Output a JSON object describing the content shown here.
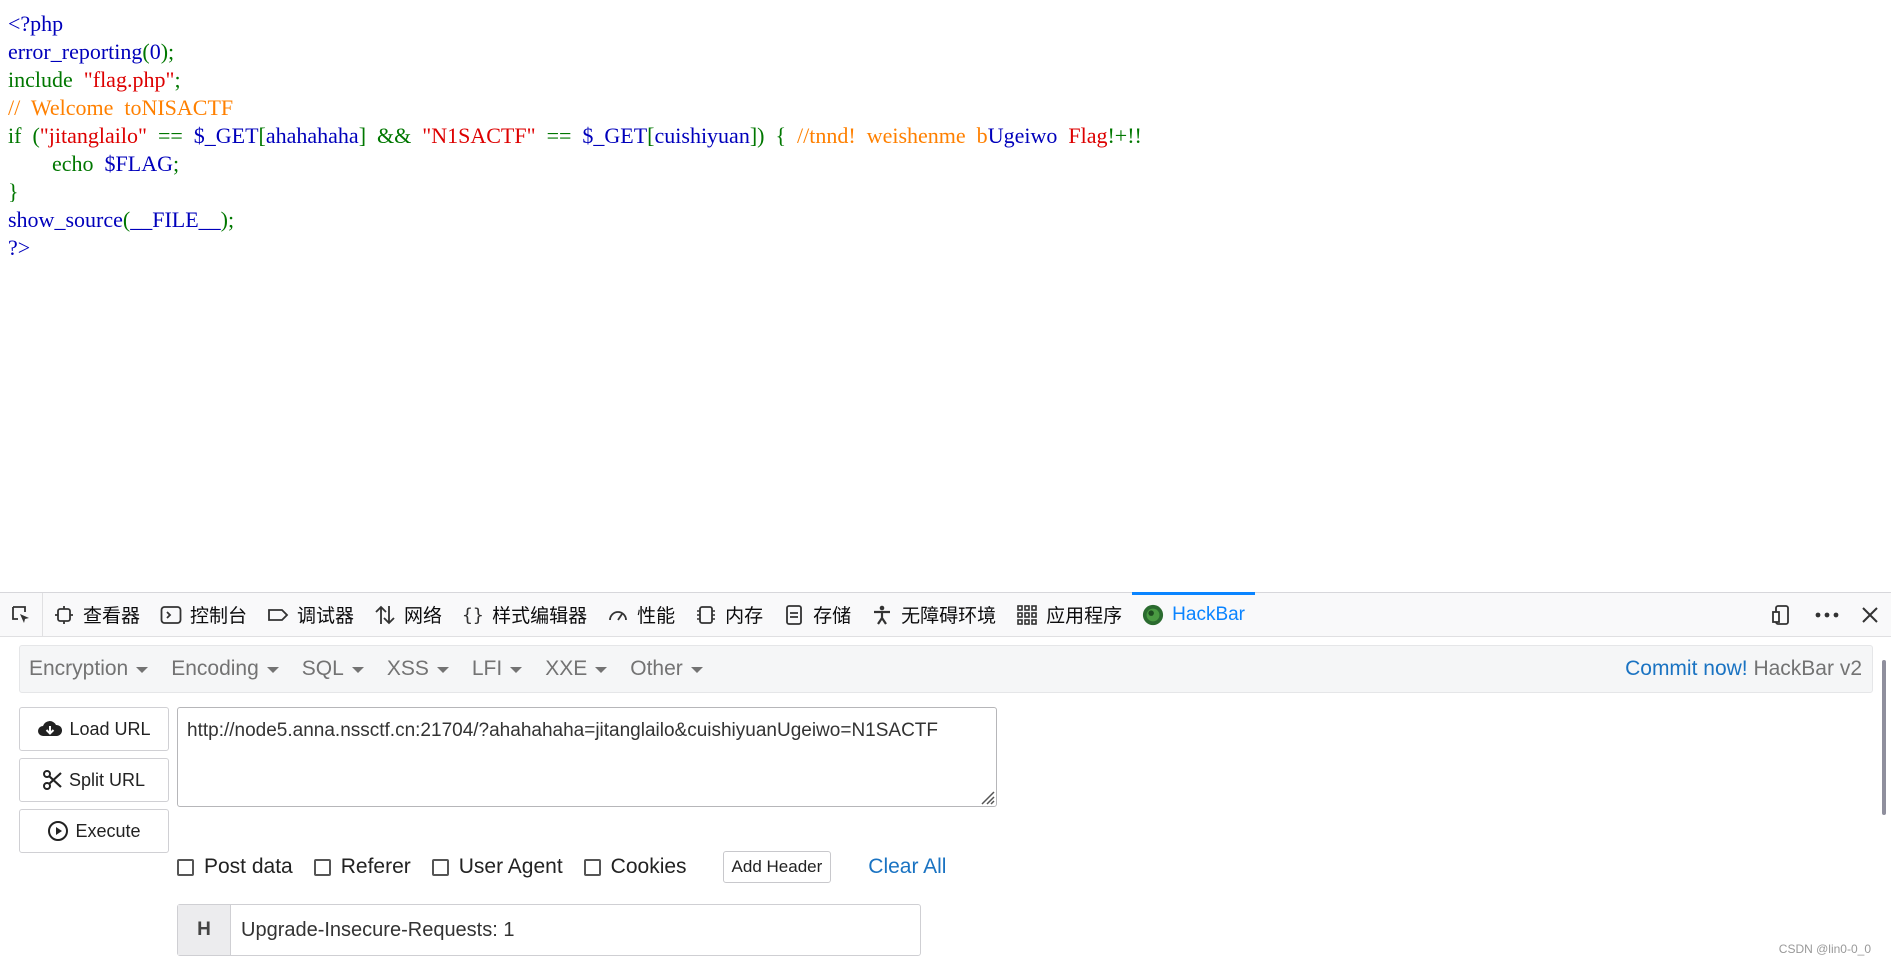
{
  "source": {
    "lines": [
      [
        {
          "t": "<?php",
          "c": "def"
        }
      ],
      [
        {
          "t": "error_reporting",
          "c": "def"
        },
        {
          "t": "(",
          "c": "kw"
        },
        {
          "t": "0",
          "c": "def"
        },
        {
          "t": ");",
          "c": "kw"
        }
      ],
      [
        {
          "t": "include  ",
          "c": "kw"
        },
        {
          "t": "\"flag.php\"",
          "c": "str"
        },
        {
          "t": ";",
          "c": "kw"
        }
      ],
      [
        {
          "t": "//  Welcome  toNISACTF",
          "c": "cm"
        }
      ],
      [
        {
          "t": "if  (",
          "c": "kw"
        },
        {
          "t": "\"jitanglailo\"",
          "c": "str"
        },
        {
          "t": "  ==  ",
          "c": "kw"
        },
        {
          "t": "$_GET",
          "c": "def"
        },
        {
          "t": "[",
          "c": "kw"
        },
        {
          "t": "ahahahaha",
          "c": "def"
        },
        {
          "t": "]  &&  ",
          "c": "kw"
        },
        {
          "t": "\"N1SACTF\"",
          "c": "str"
        },
        {
          "t": "  ==  ",
          "c": "kw"
        },
        {
          "t": "$_GET",
          "c": "def"
        },
        {
          "t": "[",
          "c": "kw"
        },
        {
          "t": "cuishiyuan",
          "c": "def"
        },
        {
          "t": "])  {  ",
          "c": "kw"
        },
        {
          "t": "//tnnd!  weishenme  b",
          "c": "cm"
        },
        {
          "t": "Ugeiwo",
          "c": "def"
        },
        {
          "t": "  ",
          "c": "kw"
        },
        {
          "t": "Flag",
          "c": "str"
        },
        {
          "t": "!+!!",
          "c": "kw"
        }
      ],
      [
        {
          "t": "        echo  ",
          "c": "kw"
        },
        {
          "t": "$FLAG",
          "c": "def"
        },
        {
          "t": ";",
          "c": "kw"
        }
      ],
      [
        {
          "t": "}",
          "c": "kw"
        }
      ],
      [
        {
          "t": "show_source",
          "c": "def"
        },
        {
          "t": "(",
          "c": "kw"
        },
        {
          "t": "__FILE__",
          "c": "def"
        },
        {
          "t": ");",
          "c": "kw"
        }
      ],
      [
        {
          "t": "?>",
          "c": "def"
        }
      ]
    ]
  },
  "devtools": {
    "tabs": [
      {
        "label": "查看器",
        "icon": "inspector-icon",
        "name": "tab-inspector"
      },
      {
        "label": "控制台",
        "icon": "console-icon",
        "name": "tab-console"
      },
      {
        "label": "调试器",
        "icon": "debugger-icon",
        "name": "tab-debugger"
      },
      {
        "label": "网络",
        "icon": "network-icon",
        "name": "tab-network"
      },
      {
        "label": "样式编辑器",
        "icon": "style-editor-icon",
        "name": "tab-style-editor"
      },
      {
        "label": "性能",
        "icon": "performance-icon",
        "name": "tab-performance"
      },
      {
        "label": "内存",
        "icon": "memory-icon",
        "name": "tab-memory"
      },
      {
        "label": "存储",
        "icon": "storage-icon",
        "name": "tab-storage"
      },
      {
        "label": "无障碍环境",
        "icon": "accessibility-icon",
        "name": "tab-accessibility"
      },
      {
        "label": "应用程序",
        "icon": "application-icon",
        "name": "tab-application"
      },
      {
        "label": "HackBar",
        "icon": "hackbar-icon",
        "name": "tab-hackbar",
        "active": true
      }
    ]
  },
  "hackbar": {
    "menu": [
      "Encryption",
      "Encoding",
      "SQL",
      "XSS",
      "LFI",
      "XXE",
      "Other"
    ],
    "commit_label": "Commit now!",
    "version_label": " HackBar v2",
    "buttons": {
      "load": "Load URL",
      "split": "Split URL",
      "execute": "Execute"
    },
    "url_value": "http://node5.anna.nssctf.cn:21704/?ahahahaha=jitanglailo&cuishiyuanUgeiwo=N1SACTF",
    "options": [
      "Post data",
      "Referer",
      "User Agent",
      "Cookies"
    ],
    "add_header_label": "Add Header",
    "clear_all_label": "Clear All",
    "header": {
      "label": "H",
      "value": "Upgrade-Insecure-Requests: 1"
    }
  },
  "watermark": "CSDN @lin0-0_0",
  "colors": {
    "keyword": "#007700",
    "string": "#dd0000",
    "comment": "#ff8000",
    "default": "#0000bb",
    "accent": "#0a84ff",
    "link": "#1a73c2"
  }
}
